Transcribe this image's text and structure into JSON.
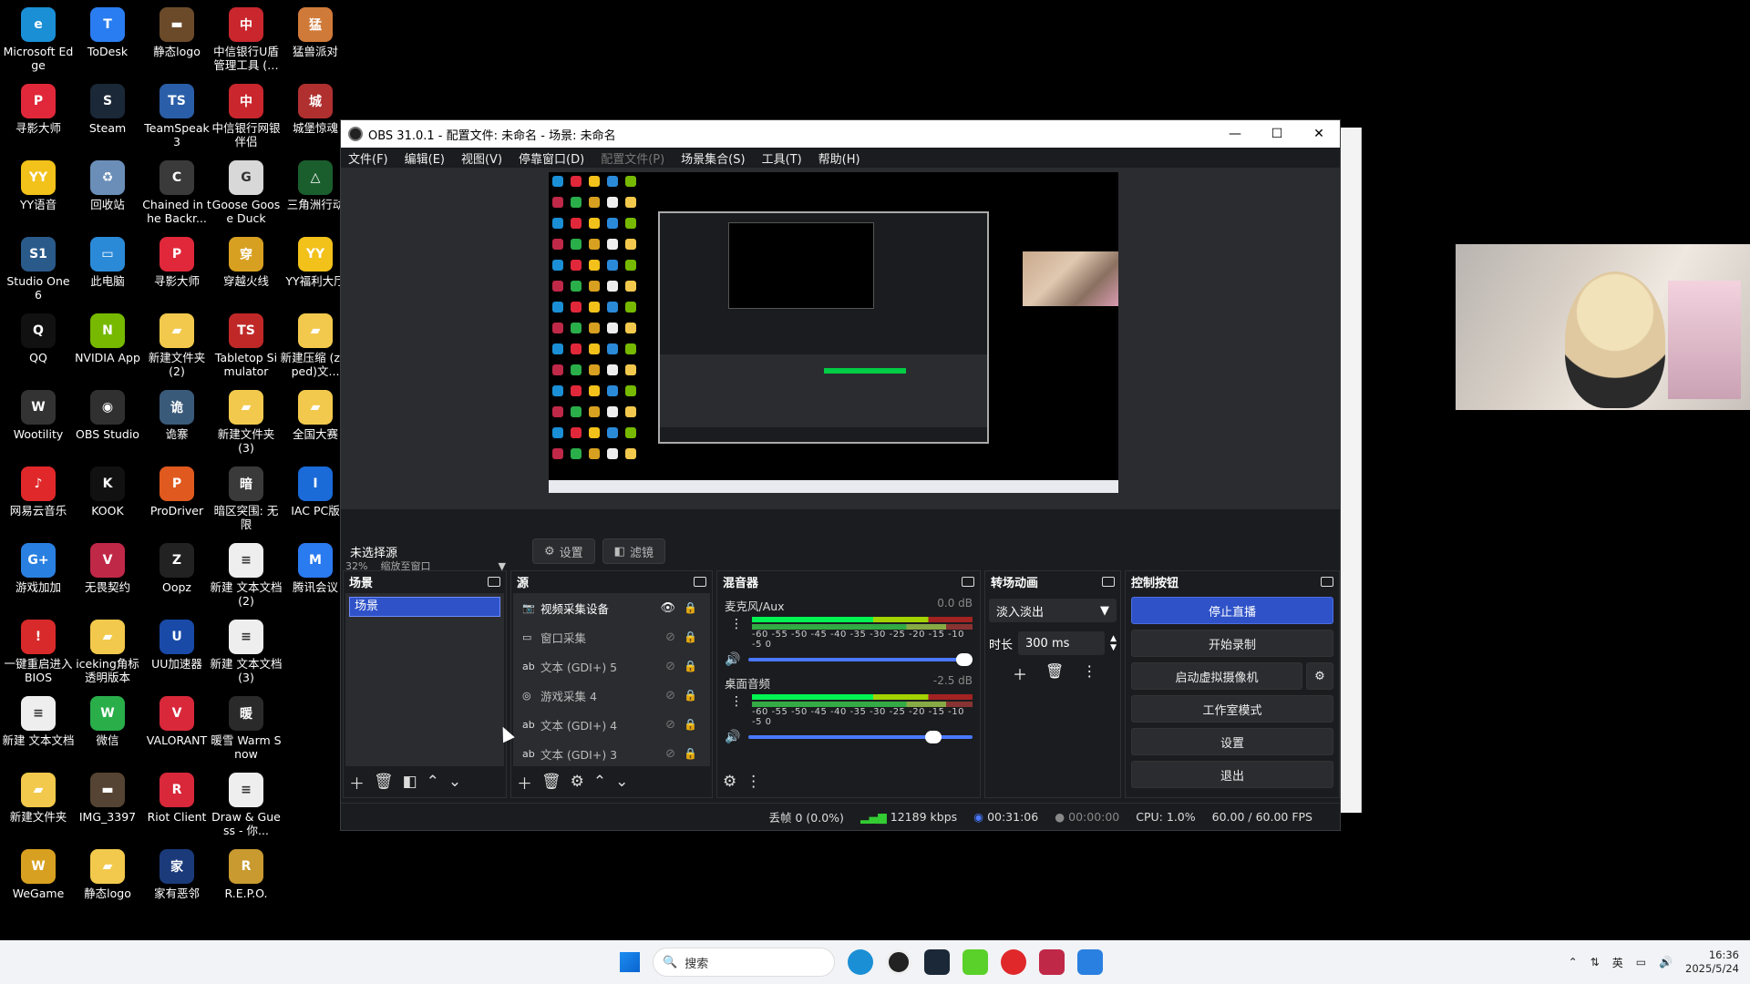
{
  "desktop": {
    "icons": [
      {
        "label": "Microsoft Edge",
        "color": "#1a8fd6",
        "glyph": "e"
      },
      {
        "label": "ToDesk",
        "color": "#2a7df0",
        "glyph": "T"
      },
      {
        "label": "静态logo",
        "color": "#6b4a2a",
        "glyph": "▬"
      },
      {
        "label": "中信银行U盾管理工具 (…",
        "color": "#c9272d",
        "glyph": "中"
      },
      {
        "label": "猛兽派对",
        "color": "#d07a3a",
        "glyph": "猛"
      },
      {
        "label": "寻影大师",
        "color": "#e0283a",
        "glyph": "P"
      },
      {
        "label": "Steam",
        "color": "#1b2838",
        "glyph": "S"
      },
      {
        "label": "TeamSpeak 3",
        "color": "#2a5ea8",
        "glyph": "TS"
      },
      {
        "label": "中信银行网银伴侣",
        "color": "#c9272d",
        "glyph": "中"
      },
      {
        "label": "城堡惊魂",
        "color": "#b03030",
        "glyph": "城"
      },
      {
        "label": "YY语音",
        "color": "#f2c11a",
        "glyph": "YY"
      },
      {
        "label": "回收站",
        "color": "#6a8eb8",
        "glyph": "♻"
      },
      {
        "label": "Chained in the Backr...",
        "color": "#3a3a3a",
        "glyph": "C"
      },
      {
        "label": "Goose Goose Duck",
        "color": "#d8d8d8",
        "glyph": "G"
      },
      {
        "label": "三角洲行动",
        "color": "#1b5e2e",
        "glyph": "△"
      },
      {
        "label": "Studio One 6",
        "color": "#2a5a8a",
        "glyph": "S1"
      },
      {
        "label": "此电脑",
        "color": "#2a8ad8",
        "glyph": "▭"
      },
      {
        "label": "寻影大师",
        "color": "#e0283a",
        "glyph": "P"
      },
      {
        "label": "穿越火线",
        "color": "#d8a020",
        "glyph": "穿"
      },
      {
        "label": "YY福利大厅",
        "color": "#f2c11a",
        "glyph": "YY"
      },
      {
        "label": "QQ",
        "color": "#111",
        "glyph": "Q"
      },
      {
        "label": "NVIDIA App",
        "color": "#76b900",
        "glyph": "N"
      },
      {
        "label": "新建文件夹 (2)",
        "color": "#f2c94c",
        "glyph": "▰"
      },
      {
        "label": "Tabletop Simulator",
        "color": "#c02828",
        "glyph": "TS"
      },
      {
        "label": "新建压缩 (zipped)文...",
        "color": "#f2c94c",
        "glyph": "▰"
      },
      {
        "label": "Wootility",
        "color": "#333",
        "glyph": "W"
      },
      {
        "label": "OBS Studio",
        "color": "#303030",
        "glyph": "◉"
      },
      {
        "label": "诡寨",
        "color": "#3a5a7a",
        "glyph": "诡"
      },
      {
        "label": "新建文件夹 (3)",
        "color": "#f2c94c",
        "glyph": "▰"
      },
      {
        "label": "全国大赛",
        "color": "#f2c94c",
        "glyph": "▰"
      },
      {
        "label": "网易云音乐",
        "color": "#e0282a",
        "glyph": "♪"
      },
      {
        "label": "KOOK",
        "color": "#111",
        "glyph": "K"
      },
      {
        "label": "ProDriver",
        "color": "#e05a20",
        "glyph": "P"
      },
      {
        "label": "暗区突围: 无限",
        "color": "#3a3a3a",
        "glyph": "暗"
      },
      {
        "label": "IAC PC版",
        "color": "#1a6ad8",
        "glyph": "I"
      },
      {
        "label": "游戏加加",
        "color": "#2a80e0",
        "glyph": "G+"
      },
      {
        "label": "无畏契约",
        "color": "#c02848",
        "glyph": "V"
      },
      {
        "label": "Oopz",
        "color": "#222",
        "glyph": "Z"
      },
      {
        "label": "新建 文本文档 (2)",
        "color": "#eeeeee",
        "glyph": "≡"
      },
      {
        "label": "腾讯会议",
        "color": "#2a7af0",
        "glyph": "M"
      },
      {
        "label": "一键重启进入BIOS",
        "color": "#d82a2a",
        "glyph": "!"
      },
      {
        "label": "iceking角标透明版本",
        "color": "#f2c94c",
        "glyph": "▰"
      },
      {
        "label": "UU加速器",
        "color": "#1a4aa8",
        "glyph": "U"
      },
      {
        "label": "新建 文本文档 (3)",
        "color": "#eeeeee",
        "glyph": "≡"
      },
      {
        "label": "",
        "color": "#000",
        "glyph": ""
      },
      {
        "label": "新建 文本文档",
        "color": "#eeeeee",
        "glyph": "≡"
      },
      {
        "label": "微信",
        "color": "#2aae4a",
        "glyph": "W"
      },
      {
        "label": "VALORANT",
        "color": "#d8283a",
        "glyph": "V"
      },
      {
        "label": "暖雪 Warm Snow",
        "color": "#2a2a2a",
        "glyph": "暖"
      },
      {
        "label": "",
        "color": "#000",
        "glyph": ""
      },
      {
        "label": "新建文件夹",
        "color": "#f2c94c",
        "glyph": "▰"
      },
      {
        "label": "IMG_3397",
        "color": "#554433",
        "glyph": "▬"
      },
      {
        "label": "Riot Client",
        "color": "#d8283a",
        "glyph": "R"
      },
      {
        "label": "Draw & Guess - 你...",
        "color": "#eeeeee",
        "glyph": "≡"
      },
      {
        "label": "",
        "color": "#000",
        "glyph": ""
      },
      {
        "label": "WeGame",
        "color": "#d8a020",
        "glyph": "W"
      },
      {
        "label": "静态logo",
        "color": "#f2c94c",
        "glyph": "▰"
      },
      {
        "label": "家有恶邻",
        "color": "#1a3a7a",
        "glyph": "家"
      },
      {
        "label": "R.E.P.O.",
        "color": "#c89a30",
        "glyph": "R"
      }
    ]
  },
  "obs": {
    "title": "OBS 31.0.1 - 配置文件: 未命名 - 场景: 未命名",
    "menu": [
      {
        "label": "文件(F)",
        "disabled": false
      },
      {
        "label": "编辑(E)",
        "disabled": false
      },
      {
        "label": "视图(V)",
        "disabled": false
      },
      {
        "label": "停靠窗口(D)",
        "disabled": false
      },
      {
        "label": "配置文件(P)",
        "disabled": true
      },
      {
        "label": "场景集合(S)",
        "disabled": false
      },
      {
        "label": "工具(T)",
        "disabled": false
      },
      {
        "label": "帮助(H)",
        "disabled": false
      }
    ],
    "zoom": {
      "percent": "32%",
      "mode": "缩放至窗口"
    },
    "source_bar": {
      "no_source": "未选择源",
      "settings_label": "设置",
      "filters_label": "滤镜"
    },
    "scenes": {
      "title": "场景",
      "items": [
        "场景"
      ]
    },
    "sources": {
      "title": "源",
      "items": [
        {
          "icon": "camera-icon",
          "glyph": "📷",
          "label": "视频采集设备",
          "visible": true
        },
        {
          "icon": "window-icon",
          "glyph": "▭",
          "label": "窗口采集",
          "visible": false
        },
        {
          "icon": "text-icon",
          "glyph": "ab",
          "label": "文本 (GDI+) 5",
          "visible": false
        },
        {
          "icon": "gamepad-icon",
          "glyph": "◎",
          "label": "游戏采集 4",
          "visible": false
        },
        {
          "icon": "text-icon",
          "glyph": "ab",
          "label": "文本 (GDI+) 4",
          "visible": false
        },
        {
          "icon": "text-icon",
          "glyph": "ab",
          "label": "文本 (GDI+) 3",
          "visible": false
        }
      ]
    },
    "mixer": {
      "title": "混音器",
      "channels": [
        {
          "name": "麦克风/Aux",
          "db": "0.0 dB",
          "volume": 1.0
        },
        {
          "name": "桌面音频",
          "db": "-2.5 dB",
          "volume": 0.86
        }
      ],
      "scale": "-60 -55 -50 -45 -40 -35 -30 -25 -20 -15 -10 -5 0"
    },
    "transitions": {
      "title": "转场动画",
      "type": "淡入淡出",
      "duration_label": "时长",
      "duration": "300 ms"
    },
    "controls": {
      "title": "控制按钮",
      "stop_stream": "停止直播",
      "start_record": "开始录制",
      "start_vcam": "启动虚拟摄像机",
      "studio_mode": "工作室模式",
      "settings": "设置",
      "exit": "退出"
    },
    "status": {
      "dropped": "丢帧 0 (0.0%)",
      "bitrate": "12189 kbps",
      "stream_time": "00:31:06",
      "record_time": "00:00:00",
      "cpu": "CPU: 1.0%",
      "fps": "60.00 / 60.00 FPS"
    }
  },
  "taskbar": {
    "search_placeholder": "搜索",
    "tray_lang": "英",
    "time": "16:36",
    "date": "2025/5/24"
  },
  "colors": {
    "accent": "#2f52c8",
    "panel": "#1b1c1f",
    "panel_body": "#2b2c30"
  }
}
